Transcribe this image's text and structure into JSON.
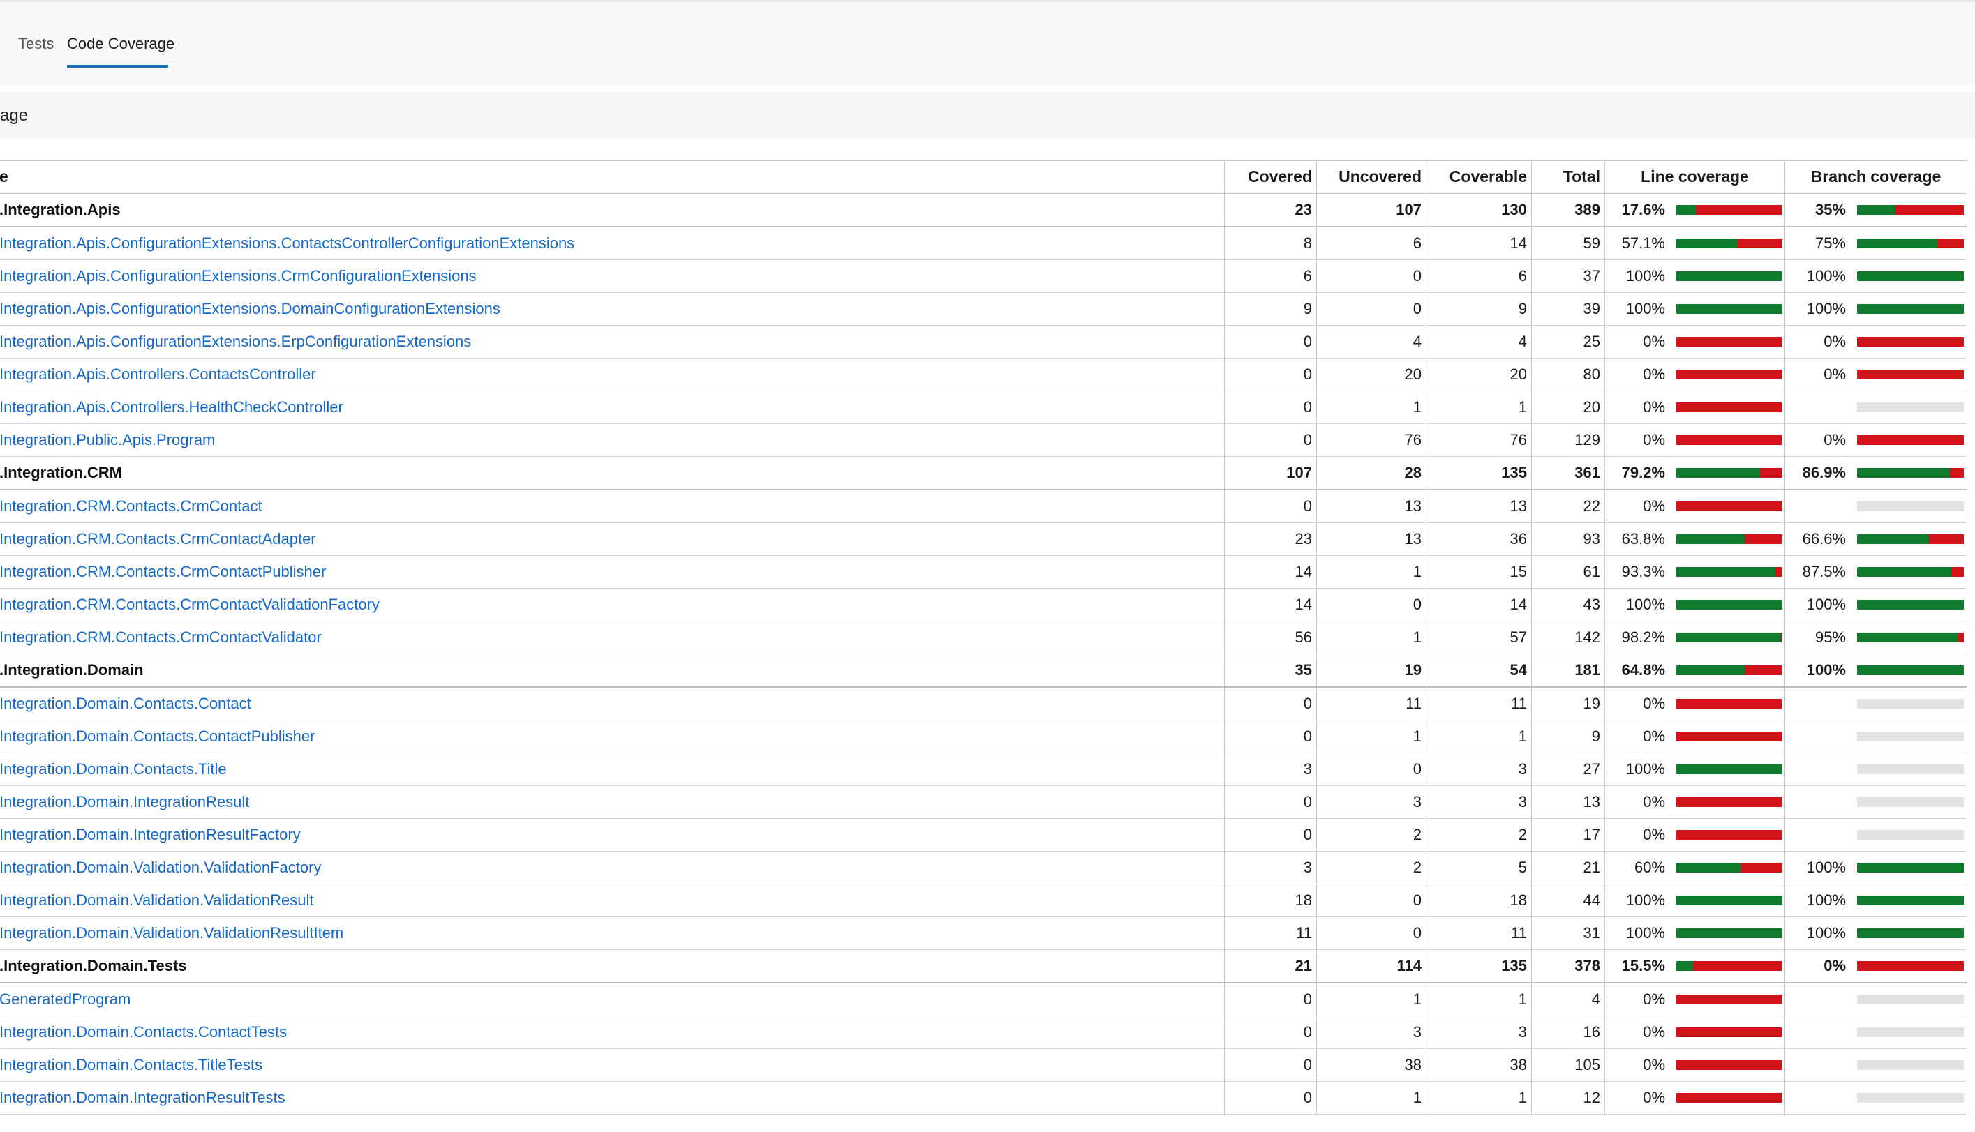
{
  "tabs": [
    {
      "label": "Tests",
      "active": false
    },
    {
      "label": "Code Coverage",
      "active": true
    }
  ],
  "section": {
    "title": "age"
  },
  "colors": {
    "covered": "#0f7b2c",
    "uncovered": "#d0141a",
    "empty": "#e2e2e2",
    "link": "#1668c7",
    "accent": "#0f6cbd"
  },
  "table": {
    "headers": {
      "name": "e",
      "covered": "Covered",
      "uncovered": "Uncovered",
      "coverable": "Coverable",
      "total": "Total",
      "line": "Line coverage",
      "branch": "Branch coverage"
    },
    "rows": [
      {
        "group": true,
        "name": ".Integration.Apis",
        "covered": "23",
        "uncovered": "107",
        "coverable": "130",
        "total": "389",
        "line_pct": "17.6%",
        "line_frac": 0.176,
        "branch_pct": "35%",
        "branch_frac": 0.35
      },
      {
        "group": false,
        "name": "Integration.Apis.ConfigurationExtensions.ContactsControllerConfigurationExtensions",
        "covered": "8",
        "uncovered": "6",
        "coverable": "14",
        "total": "59",
        "line_pct": "57.1%",
        "line_frac": 0.571,
        "branch_pct": "75%",
        "branch_frac": 0.75
      },
      {
        "group": false,
        "name": "Integration.Apis.ConfigurationExtensions.CrmConfigurationExtensions",
        "covered": "6",
        "uncovered": "0",
        "coverable": "6",
        "total": "37",
        "line_pct": "100%",
        "line_frac": 1,
        "branch_pct": "100%",
        "branch_frac": 1
      },
      {
        "group": false,
        "name": "Integration.Apis.ConfigurationExtensions.DomainConfigurationExtensions",
        "covered": "9",
        "uncovered": "0",
        "coverable": "9",
        "total": "39",
        "line_pct": "100%",
        "line_frac": 1,
        "branch_pct": "100%",
        "branch_frac": 1
      },
      {
        "group": false,
        "name": "Integration.Apis.ConfigurationExtensions.ErpConfigurationExtensions",
        "covered": "0",
        "uncovered": "4",
        "coverable": "4",
        "total": "25",
        "line_pct": "0%",
        "line_frac": 0,
        "branch_pct": "0%",
        "branch_frac": 0
      },
      {
        "group": false,
        "name": "Integration.Apis.Controllers.ContactsController",
        "covered": "0",
        "uncovered": "20",
        "coverable": "20",
        "total": "80",
        "line_pct": "0%",
        "line_frac": 0,
        "branch_pct": "0%",
        "branch_frac": 0
      },
      {
        "group": false,
        "name": "Integration.Apis.Controllers.HealthCheckController",
        "covered": "0",
        "uncovered": "1",
        "coverable": "1",
        "total": "20",
        "line_pct": "0%",
        "line_frac": 0,
        "branch_pct": "",
        "branch_frac": null
      },
      {
        "group": false,
        "name": "Integration.Public.Apis.Program",
        "covered": "0",
        "uncovered": "76",
        "coverable": "76",
        "total": "129",
        "line_pct": "0%",
        "line_frac": 0,
        "branch_pct": "0%",
        "branch_frac": 0
      },
      {
        "group": true,
        "name": ".Integration.CRM",
        "covered": "107",
        "uncovered": "28",
        "coverable": "135",
        "total": "361",
        "line_pct": "79.2%",
        "line_frac": 0.792,
        "branch_pct": "86.9%",
        "branch_frac": 0.869
      },
      {
        "group": false,
        "name": "Integration.CRM.Contacts.CrmContact",
        "covered": "0",
        "uncovered": "13",
        "coverable": "13",
        "total": "22",
        "line_pct": "0%",
        "line_frac": 0,
        "branch_pct": "",
        "branch_frac": null
      },
      {
        "group": false,
        "name": "Integration.CRM.Contacts.CrmContactAdapter",
        "covered": "23",
        "uncovered": "13",
        "coverable": "36",
        "total": "93",
        "line_pct": "63.8%",
        "line_frac": 0.638,
        "branch_pct": "66.6%",
        "branch_frac": 0.666
      },
      {
        "group": false,
        "name": "Integration.CRM.Contacts.CrmContactPublisher",
        "covered": "14",
        "uncovered": "1",
        "coverable": "15",
        "total": "61",
        "line_pct": "93.3%",
        "line_frac": 0.933,
        "branch_pct": "87.5%",
        "branch_frac": 0.875
      },
      {
        "group": false,
        "name": "Integration.CRM.Contacts.CrmContactValidationFactory",
        "covered": "14",
        "uncovered": "0",
        "coverable": "14",
        "total": "43",
        "line_pct": "100%",
        "line_frac": 1,
        "branch_pct": "100%",
        "branch_frac": 1
      },
      {
        "group": false,
        "name": "Integration.CRM.Contacts.CrmContactValidator",
        "covered": "56",
        "uncovered": "1",
        "coverable": "57",
        "total": "142",
        "line_pct": "98.2%",
        "line_frac": 0.982,
        "branch_pct": "95%",
        "branch_frac": 0.95
      },
      {
        "group": true,
        "name": ".Integration.Domain",
        "covered": "35",
        "uncovered": "19",
        "coverable": "54",
        "total": "181",
        "line_pct": "64.8%",
        "line_frac": 0.648,
        "branch_pct": "100%",
        "branch_frac": 1
      },
      {
        "group": false,
        "name": "Integration.Domain.Contacts.Contact",
        "covered": "0",
        "uncovered": "11",
        "coverable": "11",
        "total": "19",
        "line_pct": "0%",
        "line_frac": 0,
        "branch_pct": "",
        "branch_frac": null
      },
      {
        "group": false,
        "name": "Integration.Domain.Contacts.ContactPublisher",
        "covered": "0",
        "uncovered": "1",
        "coverable": "1",
        "total": "9",
        "line_pct": "0%",
        "line_frac": 0,
        "branch_pct": "",
        "branch_frac": null
      },
      {
        "group": false,
        "name": "Integration.Domain.Contacts.Title",
        "covered": "3",
        "uncovered": "0",
        "coverable": "3",
        "total": "27",
        "line_pct": "100%",
        "line_frac": 1,
        "branch_pct": "",
        "branch_frac": null
      },
      {
        "group": false,
        "name": "Integration.Domain.IntegrationResult",
        "covered": "0",
        "uncovered": "3",
        "coverable": "3",
        "total": "13",
        "line_pct": "0%",
        "line_frac": 0,
        "branch_pct": "",
        "branch_frac": null
      },
      {
        "group": false,
        "name": "Integration.Domain.IntegrationResultFactory",
        "covered": "0",
        "uncovered": "2",
        "coverable": "2",
        "total": "17",
        "line_pct": "0%",
        "line_frac": 0,
        "branch_pct": "",
        "branch_frac": null
      },
      {
        "group": false,
        "name": "Integration.Domain.Validation.ValidationFactory",
        "covered": "3",
        "uncovered": "2",
        "coverable": "5",
        "total": "21",
        "line_pct": "60%",
        "line_frac": 0.6,
        "branch_pct": "100%",
        "branch_frac": 1
      },
      {
        "group": false,
        "name": "Integration.Domain.Validation.ValidationResult",
        "covered": "18",
        "uncovered": "0",
        "coverable": "18",
        "total": "44",
        "line_pct": "100%",
        "line_frac": 1,
        "branch_pct": "100%",
        "branch_frac": 1
      },
      {
        "group": false,
        "name": "Integration.Domain.Validation.ValidationResultItem",
        "covered": "11",
        "uncovered": "0",
        "coverable": "11",
        "total": "31",
        "line_pct": "100%",
        "line_frac": 1,
        "branch_pct": "100%",
        "branch_frac": 1
      },
      {
        "group": true,
        "name": ".Integration.Domain.Tests",
        "covered": "21",
        "uncovered": "114",
        "coverable": "135",
        "total": "378",
        "line_pct": "15.5%",
        "line_frac": 0.155,
        "branch_pct": "0%",
        "branch_frac": 0
      },
      {
        "group": false,
        "name": "GeneratedProgram",
        "covered": "0",
        "uncovered": "1",
        "coverable": "1",
        "total": "4",
        "line_pct": "0%",
        "line_frac": 0,
        "branch_pct": "",
        "branch_frac": null
      },
      {
        "group": false,
        "name": "Integration.Domain.Contacts.ContactTests",
        "covered": "0",
        "uncovered": "3",
        "coverable": "3",
        "total": "16",
        "line_pct": "0%",
        "line_frac": 0,
        "branch_pct": "",
        "branch_frac": null
      },
      {
        "group": false,
        "name": "Integration.Domain.Contacts.TitleTests",
        "covered": "0",
        "uncovered": "38",
        "coverable": "38",
        "total": "105",
        "line_pct": "0%",
        "line_frac": 0,
        "branch_pct": "",
        "branch_frac": null
      },
      {
        "group": false,
        "name": "Integration.Domain.IntegrationResultTests",
        "covered": "0",
        "uncovered": "1",
        "coverable": "1",
        "total": "12",
        "line_pct": "0%",
        "line_frac": 0,
        "branch_pct": "",
        "branch_frac": null
      }
    ]
  }
}
